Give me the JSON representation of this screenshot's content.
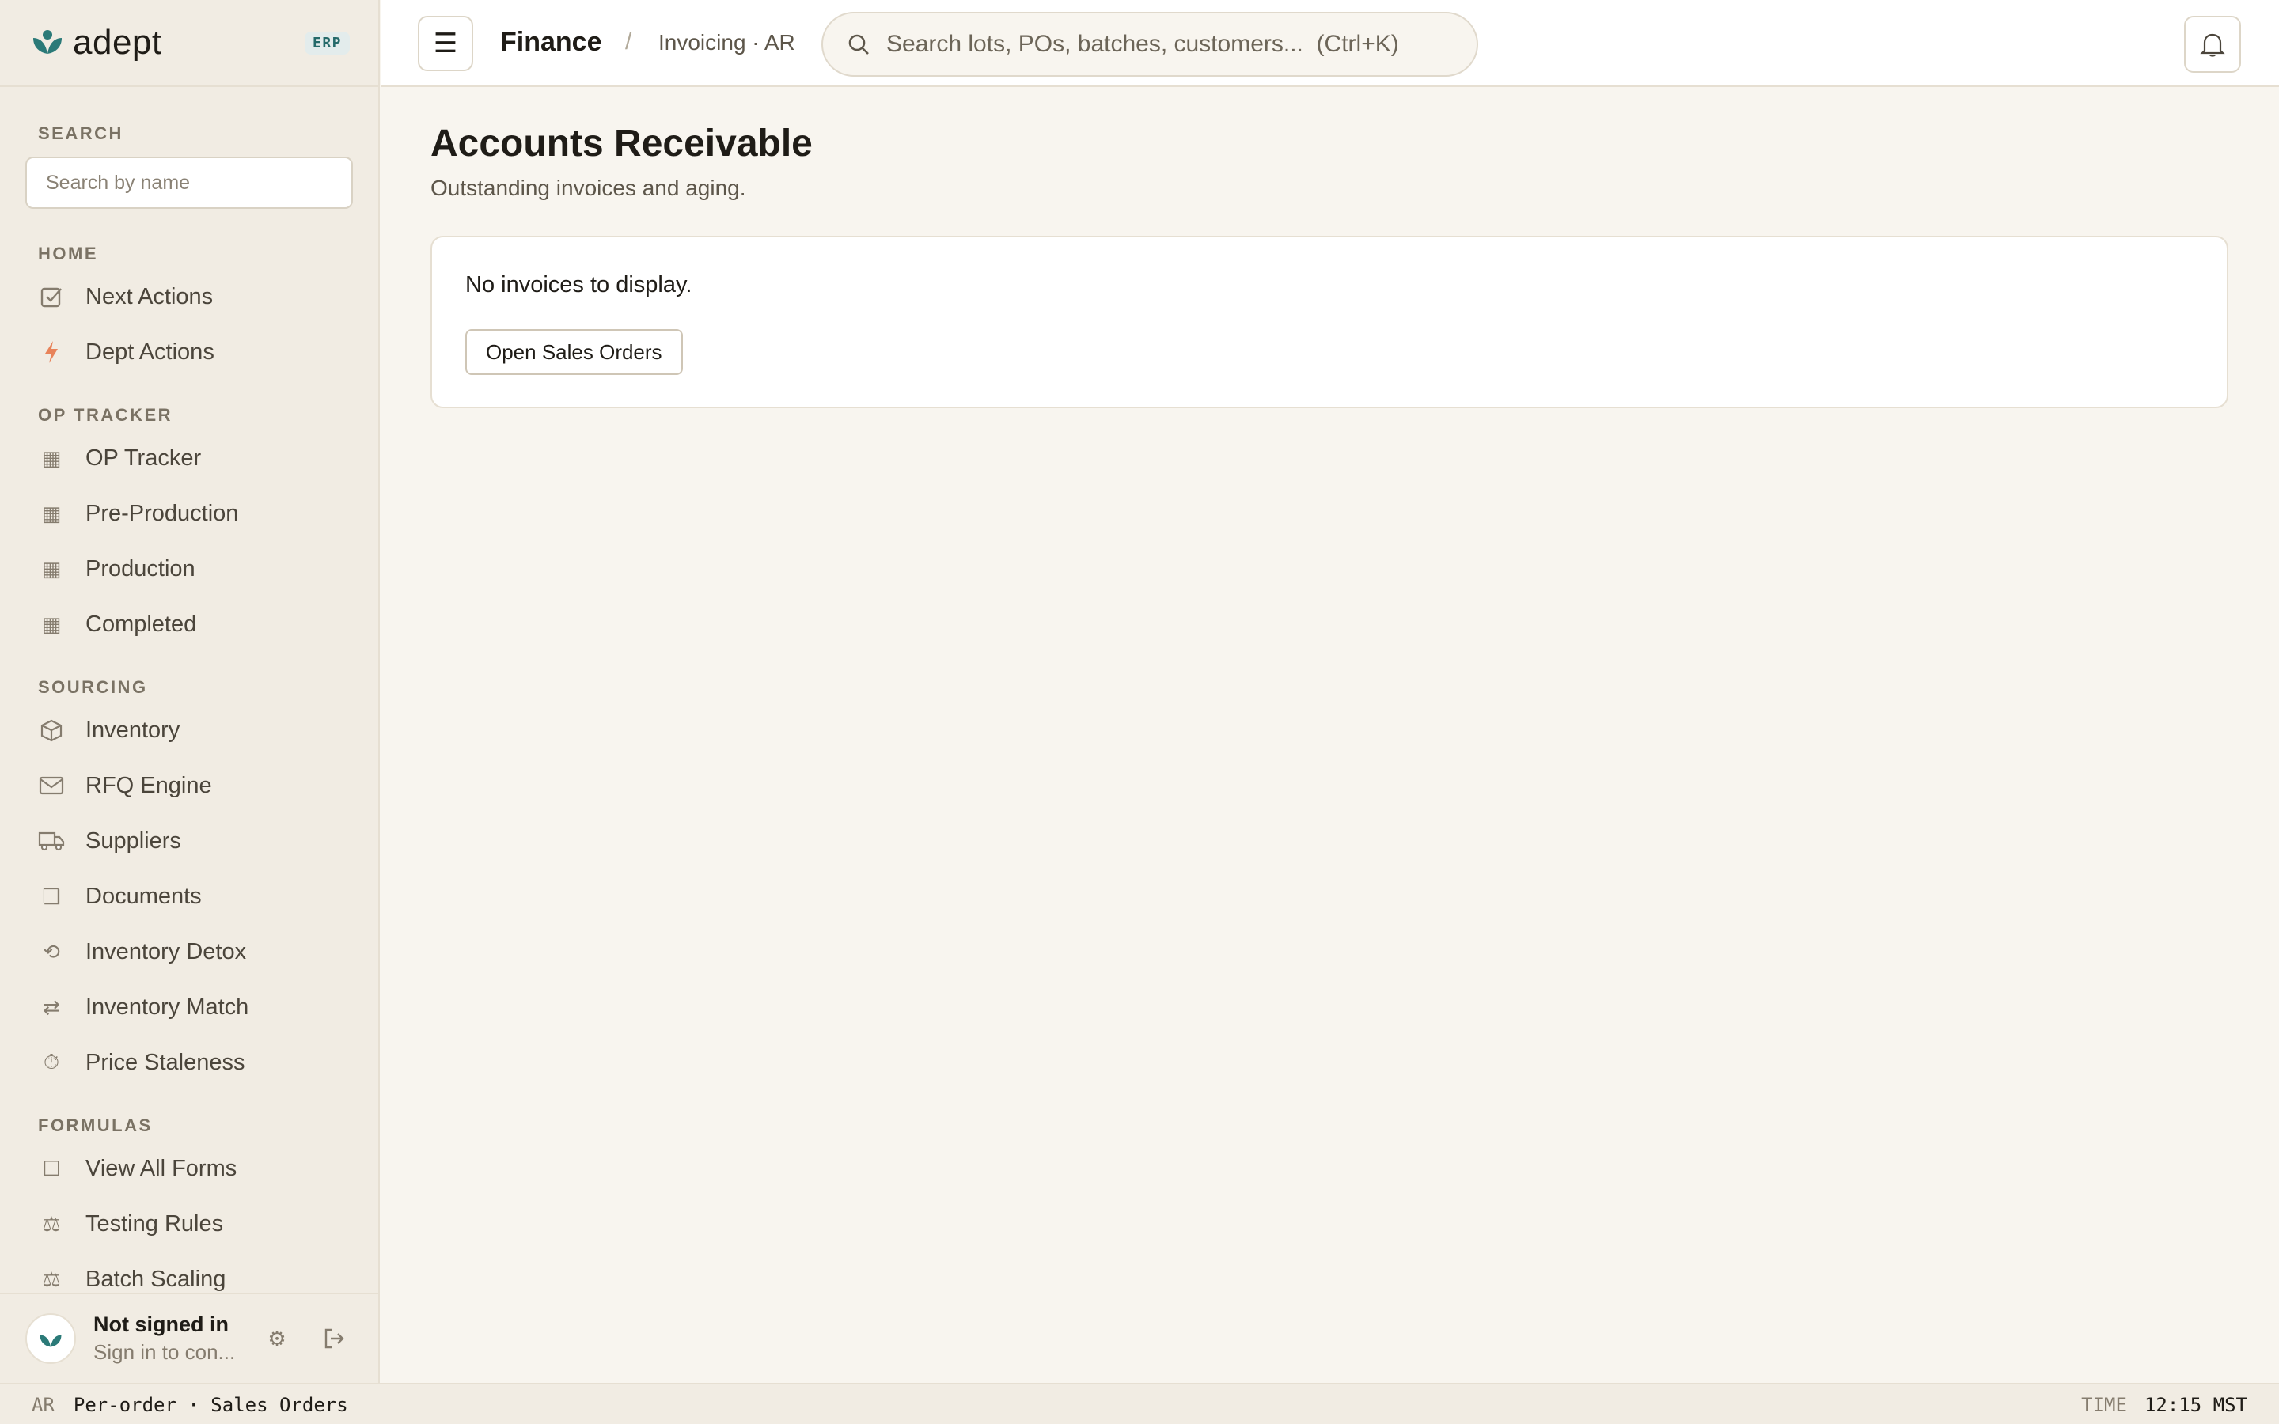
{
  "app": {
    "brand": "adept",
    "badge": "ERP"
  },
  "sidebar": {
    "search_label": "SEARCH",
    "search_placeholder": "Search by name",
    "sections": [
      {
        "label": "HOME",
        "items": [
          {
            "label": "Next Actions",
            "icon": "checkbox-icon"
          },
          {
            "label": "Dept Actions",
            "icon": "bolt-icon"
          }
        ]
      },
      {
        "label": "OP TRACKER",
        "items": [
          {
            "label": "OP Tracker",
            "icon": "grid-icon"
          },
          {
            "label": "Pre-Production",
            "icon": "grid-icon"
          },
          {
            "label": "Production",
            "icon": "grid-icon"
          },
          {
            "label": "Completed",
            "icon": "grid-icon"
          }
        ]
      },
      {
        "label": "SOURCING",
        "items": [
          {
            "label": "Inventory",
            "icon": "box-icon"
          },
          {
            "label": "RFQ Engine",
            "icon": "mail-icon"
          },
          {
            "label": "Suppliers",
            "icon": "truck-icon"
          },
          {
            "label": "Documents",
            "icon": "document-icon"
          },
          {
            "label": "Inventory Detox",
            "icon": "refresh-icon"
          },
          {
            "label": "Inventory Match",
            "icon": "swap-icon"
          },
          {
            "label": "Price Staleness",
            "icon": "timer-icon"
          }
        ]
      },
      {
        "label": "FORMULAS",
        "items": [
          {
            "label": "View All Forms",
            "icon": "square-icon"
          },
          {
            "label": "Testing Rules",
            "icon": "scale-icon"
          },
          {
            "label": "Batch Scaling",
            "icon": "scale-icon"
          }
        ]
      }
    ],
    "user": {
      "name": "Not signed in",
      "sub": "Sign in to con..."
    }
  },
  "topbar": {
    "crumb_main": "Finance",
    "crumb_sep": "/",
    "crumb_sub": "Invoicing · AR",
    "search_placeholder": "Search lots, POs, batches, customers...  (Ctrl+K)"
  },
  "main": {
    "title": "Accounts Receivable",
    "subtitle": "Outstanding invoices and aging.",
    "empty_text": "No invoices to display.",
    "button_label": "Open Sales Orders"
  },
  "statusbar": {
    "left_tag": "AR",
    "left_value": "Per-order · Sales Orders",
    "right_tag": "TIME",
    "right_value": "12:15 MST"
  }
}
